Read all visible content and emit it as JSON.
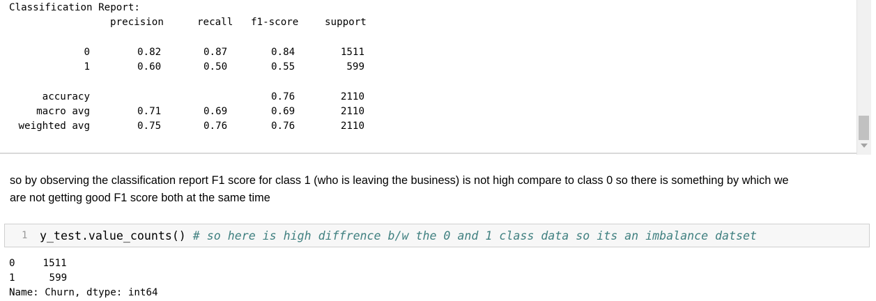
{
  "report": {
    "title": "Classification Report:",
    "headers": [
      "precision",
      "recall",
      "f1-score",
      "support"
    ],
    "rows": [
      {
        "label": "0",
        "precision": "0.82",
        "recall": "0.87",
        "f1": "0.84",
        "support": "1511"
      },
      {
        "label": "1",
        "precision": "0.60",
        "recall": "0.50",
        "f1": "0.55",
        "support": "599"
      }
    ],
    "summary": [
      {
        "label": "accuracy",
        "precision": "",
        "recall": "",
        "f1": "0.76",
        "support": "2110"
      },
      {
        "label": "macro avg",
        "precision": "0.71",
        "recall": "0.69",
        "f1": "0.69",
        "support": "2110"
      },
      {
        "label": "weighted avg",
        "precision": "0.75",
        "recall": "0.76",
        "f1": "0.76",
        "support": "2110"
      }
    ]
  },
  "markdown": {
    "line1": "so by observing the classification report F1 score for class 1 (who is leaving the business) is not high compare to class 0 so there is something by which we",
    "line2": "are not getting good F1 score both at the same time"
  },
  "cell": {
    "line_number": "1",
    "code": "y_test.value_counts()",
    "comment": " # so here is high diffrence b/w the 0 and 1 class data so its an imbalance datset"
  },
  "output": {
    "rows": [
      {
        "index": "0",
        "value": "1511"
      },
      {
        "index": "1",
        "value": "599"
      }
    ],
    "footer": "Name: Churn, dtype: int64"
  }
}
